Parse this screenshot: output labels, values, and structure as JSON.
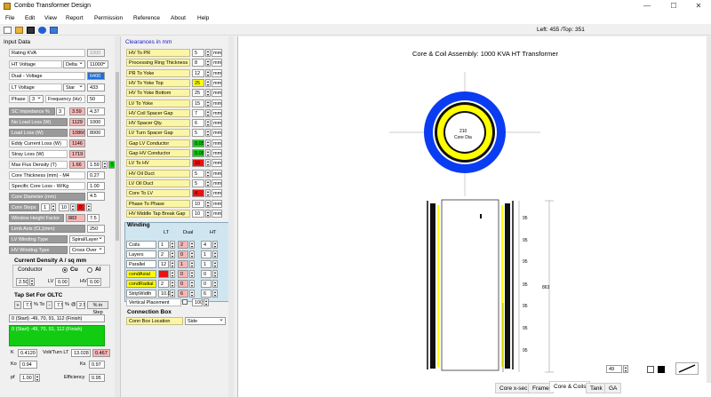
{
  "window": {
    "title": "Combo Transformer Design",
    "minimize": "—",
    "maximize": "☐",
    "close": "✕"
  },
  "menu": [
    "File",
    "Edit",
    "View",
    "Report",
    "Permission",
    "Reference",
    "About",
    "Help"
  ],
  "toolbar": {
    "coords": "Left: 455 /Top: 351"
  },
  "input": {
    "header": "Input Data",
    "rating_label": "Rating KVA",
    "rating_value": "1000",
    "hv_voltage_label": "HT Voltage",
    "hv_conn": "Delta",
    "hv_voltage": "11000",
    "dual_voltage_label": "Dual - Voltage",
    "dual_voltage": "6400",
    "lv_voltage_label": "LT Voltage",
    "lv_conn": "Star",
    "lv_voltage": "433",
    "phase_label": "Phase",
    "phase": "3",
    "freq_label": "Frequency (Hz)",
    "freq": "50",
    "sc_label": "SC Impedance %",
    "sc_a": "3",
    "sc_b": "3.59",
    "sc_c": "4.37",
    "nll_label": "No Load Loss (W)",
    "nll_a": "1129",
    "nll_b": "1000",
    "ll_label": "Load Loss (W)",
    "ll_a": "10866",
    "ll_b": "8000",
    "eddy_label": "Eddy Current  Loss (W)",
    "eddy": "1146",
    "stray_label": "Stray Loss (W)",
    "stray": "1719",
    "flux_label": "Max Flux Density (T)",
    "flux_a": "1.66",
    "flux_b": "1.59",
    "flux_c": "5",
    "core_thk_label": "Core Thickness (mm) - M4",
    "core_thk": "0.27",
    "spec_loss_label": "Specific Core Loss - W/Kg",
    "spec_loss": "1.00",
    "core_dia_label": "Core Diameter (mm)",
    "core_dia": "4.5",
    "core_steps_label": "Core Steps",
    "core_steps_a": "1",
    "core_steps_b": "10",
    "core_steps_c": "0",
    "window_height_label": "Window Height Factor",
    "window_height_a": "883",
    "window_height_b": "7.5",
    "limb_axis_label": "Limb Axis (CL)(mm)",
    "limb_axis": "250",
    "lv_winding_type_label": "LV Winding Type",
    "lv_winding_type": "Spiral/Layer",
    "hv_winding_type_label": "HV Winding Type",
    "hv_winding_type": "Cross Over",
    "cd_header": "Current Density A / sq mm",
    "conductor_label": "Conductor",
    "cu": "Cu",
    "al": "Al",
    "cd_a": "2.50",
    "cd_lv_label": "LV",
    "cd_lv": "0.00",
    "cd_hv_label": "HV",
    "cd_hv": "0.00",
    "tap_header": "Tap Set For OLTC",
    "tap_plus": "+",
    "tap_pos": "7.5",
    "tap_pct_to": "% To",
    "tap_minus": "-",
    "tap_neg": "7.5",
    "tap_pct": "%",
    "tap_step_at": "@",
    "tap_step": "2.5",
    "tap_in_step": "% in Step",
    "tap_line": "0 (Start) -49, 70, 91, 112 (Finish)",
    "tap_green": "0 (Start) -49, 70, 91, 112 (Finish)",
    "k_label": "K",
    "k": "0.4120",
    "vt_label": "Volt/Turn LT",
    "vt_a": "13.028",
    "vt_b": "0.467",
    "ko_label": "Ko",
    "ko": "0.94",
    "ks_label": "Ks",
    "ks": "0.97",
    "pf_label": "pf",
    "pf": "1.00",
    "eff_label": "Efficiency",
    "eff": "0.95"
  },
  "clearances": {
    "header": "Clearances in mm",
    "rows": [
      {
        "label": "HV To PR",
        "value": "5",
        "style": "w"
      },
      {
        "label": "Processing Ring Thickness",
        "value": "8",
        "style": "w"
      },
      {
        "label": "PR To Yoke",
        "value": "12",
        "style": "w"
      },
      {
        "label": "HV To Yoke Top",
        "value": "25",
        "style": "y"
      },
      {
        "label": "HV To Yoke Bottom",
        "value": "25",
        "style": "w"
      },
      {
        "label": "LV To Yoke",
        "value": "15",
        "style": "w"
      },
      {
        "label": "HV Coil Spacer Gap",
        "value": "7",
        "style": "w"
      },
      {
        "label": "HV Spacer Qty.",
        "value": "6",
        "style": "w"
      },
      {
        "label": "LV Turn Spacer Gap",
        "value": "5",
        "style": "w"
      },
      {
        "label": "Gap LV Conductor",
        "value": "0.05",
        "style": "w"
      },
      {
        "label": "Gap HV Conductor",
        "value": "0.05",
        "style": "w"
      },
      {
        "label": "LV To HV",
        "value": "10",
        "style": "w"
      },
      {
        "label": "HV Oil Duct",
        "value": "5",
        "style": "w"
      },
      {
        "label": "LV Oil Duct",
        "value": "5",
        "style": "w"
      },
      {
        "label": "Core To LV",
        "value": "4",
        "style": "w"
      },
      {
        "label": "Phase To Phase",
        "value": "10",
        "style": "w"
      },
      {
        "label": "HV Middle Tap Break Gap",
        "value": "10",
        "style": "w"
      }
    ],
    "unit": "mm",
    "winding_header": "Winding",
    "winding_cols": [
      "LT",
      "Dual",
      "HT"
    ],
    "winding_rows": [
      {
        "label": "Coils",
        "lt": "1",
        "dual": "2",
        "ht": "4"
      },
      {
        "label": "Layers",
        "lt": "2",
        "dual": "0",
        "ht": "1"
      },
      {
        "label": "Parallel",
        "lt": "12",
        "dual": "1",
        "ht": "1"
      },
      {
        "label": "condAxial",
        "lt": "",
        "dual": "0",
        "ht": "0"
      },
      {
        "label": "condRadial",
        "lt": "2",
        "dual": "0",
        "ht": "0"
      },
      {
        "label": "StripWidth",
        "lt": "10.0",
        "dual": "6",
        "ht": "6"
      }
    ],
    "vertical_label": "Vertical Placement",
    "vertical_value": "100",
    "conn_box_header": "Connection Box",
    "conn_box_label": "Conn Box Location",
    "conn_box_value": "Side"
  },
  "drawing": {
    "title": "Core & Coil Assembly: 1000 KVA HT Transformer",
    "core_dia_text": "210",
    "core_dia_sub": "Core Dia",
    "dim_labels": [
      "95",
      "95",
      "95",
      "95",
      "95",
      "95",
      "95"
    ],
    "height_label": "863",
    "zoom": "49"
  },
  "tabs": [
    "Core x-sec",
    "Frame",
    "Core & Coils",
    "Tank",
    "GA"
  ],
  "colors": {
    "hv_ring": "#0a3cf2",
    "lv_ring": "#ffff00",
    "dark": "#101010",
    "accent": "#1c1"
  }
}
